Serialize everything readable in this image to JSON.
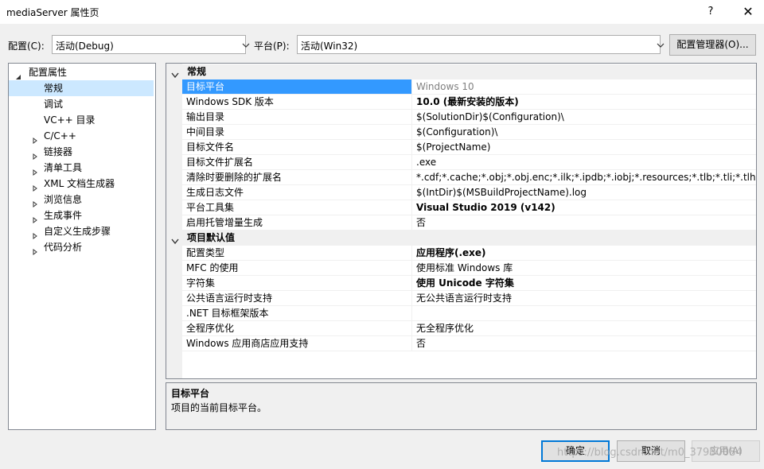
{
  "window": {
    "title": "mediaServer 属性页",
    "help_glyph": "?",
    "close_glyph": "✕"
  },
  "config_bar": {
    "config_label": "配置(C):",
    "config_value": "活动(Debug)",
    "platform_label": "平台(P):",
    "platform_value": "活动(Win32)",
    "config_manager_label": "配置管理器(O)..."
  },
  "tree": {
    "root": "配置属性",
    "items": [
      {
        "label": "常规",
        "expandable": false,
        "selected": true
      },
      {
        "label": "调试",
        "expandable": false,
        "selected": false
      },
      {
        "label": "VC++ 目录",
        "expandable": false,
        "selected": false
      },
      {
        "label": "C/C++",
        "expandable": true,
        "selected": false
      },
      {
        "label": "链接器",
        "expandable": true,
        "selected": false
      },
      {
        "label": "清单工具",
        "expandable": true,
        "selected": false
      },
      {
        "label": "XML 文档生成器",
        "expandable": true,
        "selected": false
      },
      {
        "label": "浏览信息",
        "expandable": true,
        "selected": false
      },
      {
        "label": "生成事件",
        "expandable": true,
        "selected": false
      },
      {
        "label": "自定义生成步骤",
        "expandable": true,
        "selected": false
      },
      {
        "label": "代码分析",
        "expandable": true,
        "selected": false
      }
    ]
  },
  "grid": {
    "categories": [
      {
        "label": "常规",
        "rows": [
          {
            "name": "目标平台",
            "value": "Windows 10",
            "style": "gray",
            "selected": true
          },
          {
            "name": "Windows SDK 版本",
            "value": "10.0 (最新安装的版本)",
            "style": "bold"
          },
          {
            "name": "输出目录",
            "value": "$(SolutionDir)$(Configuration)\\",
            "style": ""
          },
          {
            "name": "中间目录",
            "value": "$(Configuration)\\",
            "style": ""
          },
          {
            "name": "目标文件名",
            "value": "$(ProjectName)",
            "style": ""
          },
          {
            "name": "目标文件扩展名",
            "value": ".exe",
            "style": ""
          },
          {
            "name": "清除时要删除的扩展名",
            "value": "*.cdf;*.cache;*.obj;*.obj.enc;*.ilk;*.ipdb;*.iobj;*.resources;*.tlb;*.tli;*.tlh;*.tmp;*",
            "style": ""
          },
          {
            "name": "生成日志文件",
            "value": "$(IntDir)$(MSBuildProjectName).log",
            "style": ""
          },
          {
            "name": "平台工具集",
            "value": "Visual Studio 2019 (v142)",
            "style": "bold"
          },
          {
            "name": "启用托管增量生成",
            "value": "否",
            "style": ""
          }
        ]
      },
      {
        "label": "项目默认值",
        "rows": [
          {
            "name": "配置类型",
            "value": "应用程序(.exe)",
            "style": "bold"
          },
          {
            "name": "MFC 的使用",
            "value": "使用标准 Windows 库",
            "style": ""
          },
          {
            "name": "字符集",
            "value": "使用 Unicode 字符集",
            "style": "bold"
          },
          {
            "name": "公共语言运行时支持",
            "value": "无公共语言运行时支持",
            "style": ""
          },
          {
            "name": ".NET 目标框架版本",
            "value": "",
            "style": ""
          },
          {
            "name": "全程序优化",
            "value": "无全程序优化",
            "style": ""
          },
          {
            "name": "Windows 应用商店应用支持",
            "value": "否",
            "style": ""
          }
        ]
      }
    ]
  },
  "description": {
    "title": "目标平台",
    "text": "项目的当前目标平台。"
  },
  "buttons": {
    "ok": "确定",
    "cancel": "取消",
    "apply": "应用(A)"
  },
  "watermark": "https://blog.csdn.net/m0_37930084",
  "colors": {
    "selection": "#3399ff",
    "tree_selection": "#cce8ff",
    "accent_border": "#0078d7"
  }
}
